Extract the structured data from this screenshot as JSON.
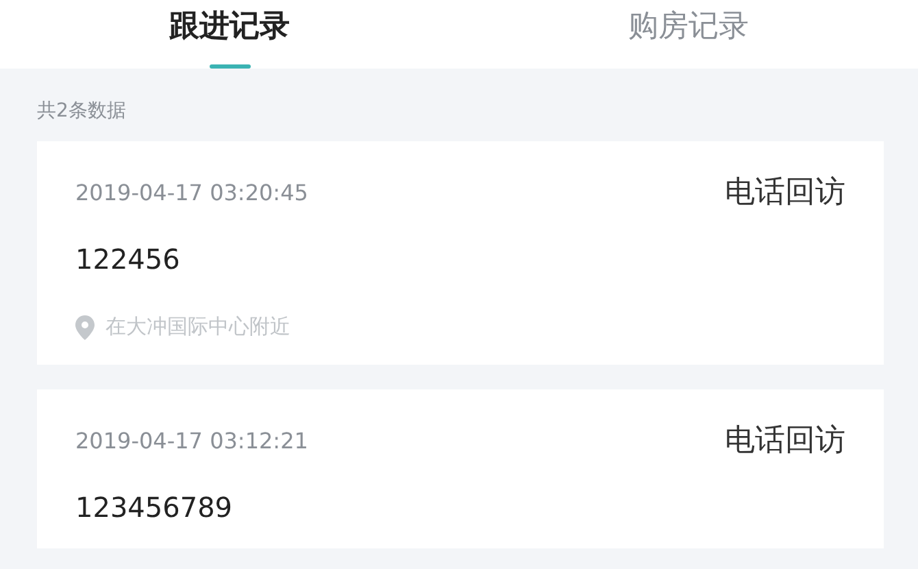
{
  "tabs": [
    {
      "label": "跟进记录",
      "selected": true
    },
    {
      "label": "购房记录",
      "selected": false
    }
  ],
  "summary": "共2条数据",
  "records": [
    {
      "time": "2019-04-17 03:20:45",
      "type": "电话回访",
      "content": "122456",
      "location": "在大冲国际中心附近"
    },
    {
      "time": "2019-04-17 03:12:21",
      "type": "电话回访",
      "content": "123456789"
    }
  ]
}
